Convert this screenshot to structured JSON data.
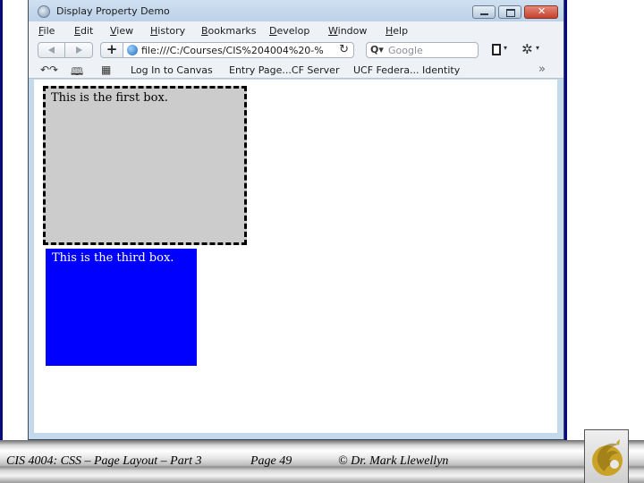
{
  "window": {
    "title": "Display Property Demo"
  },
  "menu": [
    "File",
    "Edit",
    "View",
    "History",
    "Bookmarks",
    "Develop",
    "Window",
    "Help"
  ],
  "navbar": {
    "url": "file:///C:/Courses/CIS%204004%20-%",
    "search_placeholder": "Google",
    "add_label": "+"
  },
  "bookmarks": {
    "items": [
      "Log In to Canvas",
      "Entry Page...CF Server",
      "UCF Federa... Identity"
    ],
    "more": "»"
  },
  "page": {
    "first_box_text": "This is the first box.",
    "third_box_text": "This is the third box.",
    "first_box_color": "#cccccc",
    "third_box_color": "#0000ff"
  },
  "footer": {
    "course": "CIS 4004: CSS – Page Layout – Part 3",
    "page": "Page 49",
    "author": "© Dr. Mark Llewellyn"
  },
  "icons": {
    "reload": "↻",
    "search": "Q▾",
    "tools": "✲",
    "caret": "▾",
    "history": "↶↷",
    "reader": "🕮",
    "apps": "▦"
  }
}
